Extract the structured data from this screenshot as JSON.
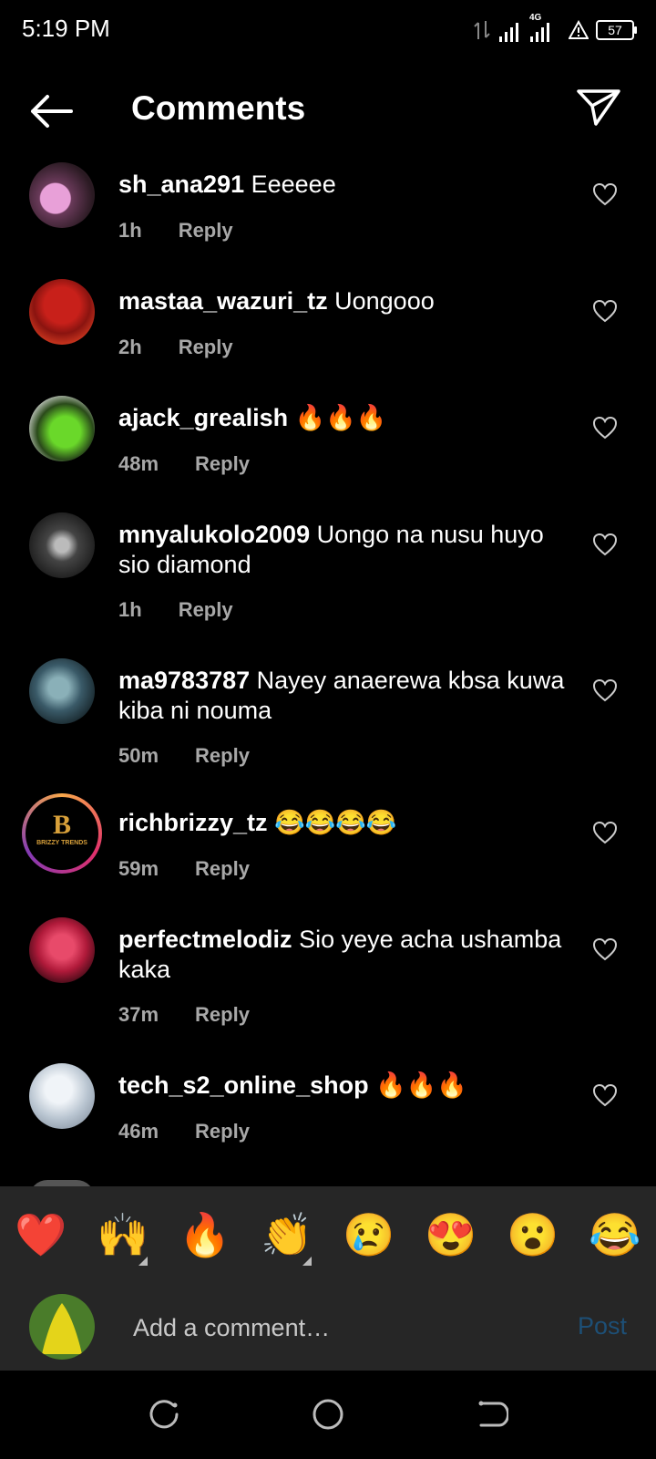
{
  "status_bar": {
    "time": "5:19 PM",
    "network": "4G",
    "battery": "57"
  },
  "header": {
    "title": "Comments"
  },
  "comments": [
    {
      "username": "sh_ana291",
      "text": "Eeeeee",
      "time": "1h",
      "reply": "Reply"
    },
    {
      "username": "mastaa_wazuri_tz",
      "text": "Uongooo",
      "time": "2h",
      "reply": "Reply"
    },
    {
      "username": "ajack_grealish",
      "text": "🔥🔥🔥",
      "time": "48m",
      "reply": "Reply"
    },
    {
      "username": "mnyalukolo2009",
      "text": "Uongo na nusu huyo sio diamond",
      "time": "1h",
      "reply": "Reply"
    },
    {
      "username": "ma9783787",
      "text": "Nayey anaerewa kbsa kuwa kiba ni nouma",
      "time": "50m",
      "reply": "Reply"
    },
    {
      "username": "richbrizzy_tz",
      "text": "😂😂😂😂",
      "time": "59m",
      "reply": "Reply",
      "avatar_text": "BRIZZY TRENDS"
    },
    {
      "username": "perfectmelodiz",
      "text": "Sio yeye acha ushamba kaka",
      "time": "37m",
      "reply": "Reply"
    },
    {
      "username": "tech_s2_online_shop",
      "text": "🔥🔥🔥",
      "time": "46m",
      "reply": "Reply"
    }
  ],
  "reactions": [
    "❤️",
    "🙌",
    "🔥",
    "👏",
    "😢",
    "😍",
    "😮",
    "😂"
  ],
  "input": {
    "placeholder": "Add a comment…",
    "post_label": "Post"
  },
  "colors": {
    "background": "#000000",
    "bar": "#262626",
    "post_disabled": "#1d4f76",
    "meta": "#a8a8a8"
  }
}
